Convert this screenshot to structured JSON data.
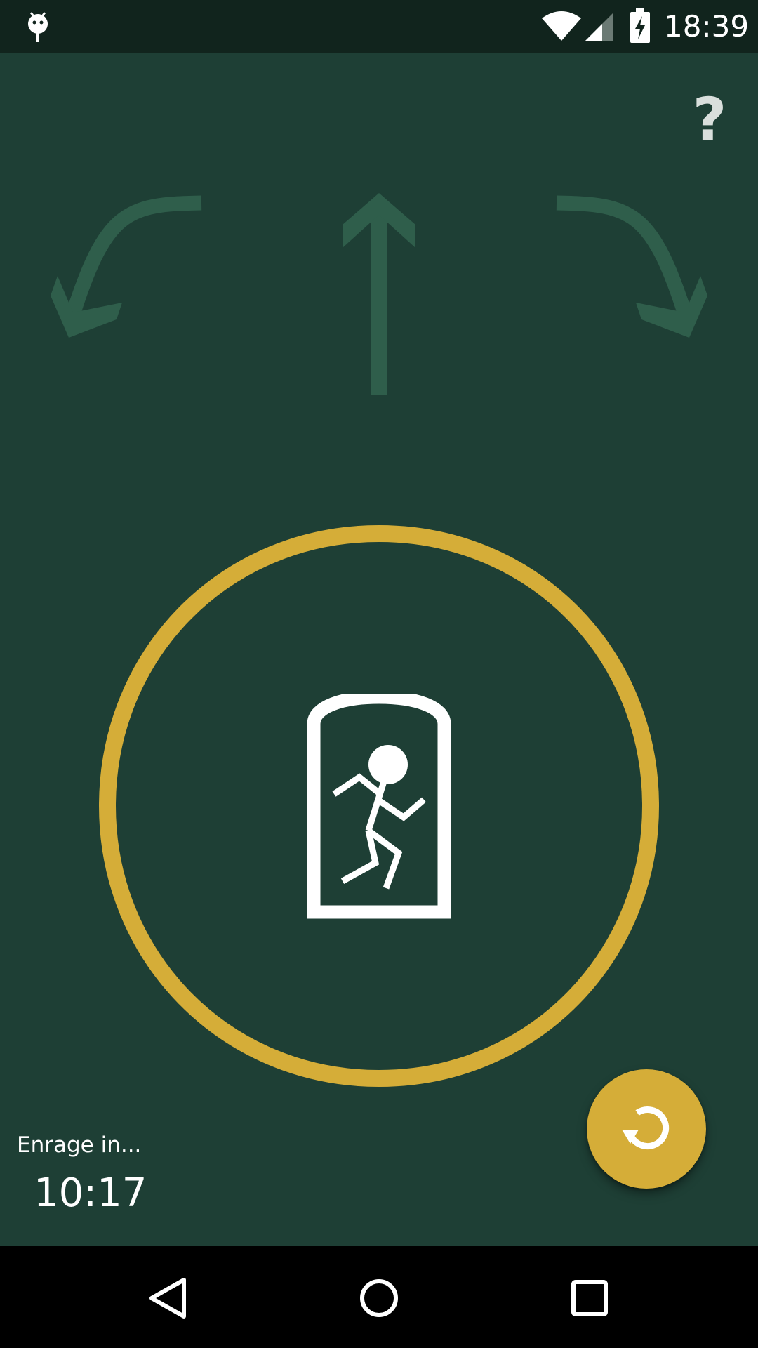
{
  "status_bar": {
    "time": "18:39",
    "icons": [
      "debug-icon",
      "wifi-icon",
      "signal-icon",
      "battery-charging-icon"
    ]
  },
  "help": {
    "label": "?"
  },
  "direction_arrows": {
    "left": "curved-arrow-left-down-icon",
    "center": "arrow-up-icon",
    "right": "curved-arrow-right-down-icon",
    "color": "#2f5e4b"
  },
  "target": {
    "icon": "running-figure-in-doorway-icon",
    "ring_color": "#d5ad38"
  },
  "enrage": {
    "label": "Enrage in...",
    "time": "10:17"
  },
  "reset_button": {
    "icon": "refresh-icon",
    "color": "#d5ad38"
  },
  "navigation": {
    "items": [
      "back-icon",
      "home-icon",
      "recents-icon"
    ]
  }
}
